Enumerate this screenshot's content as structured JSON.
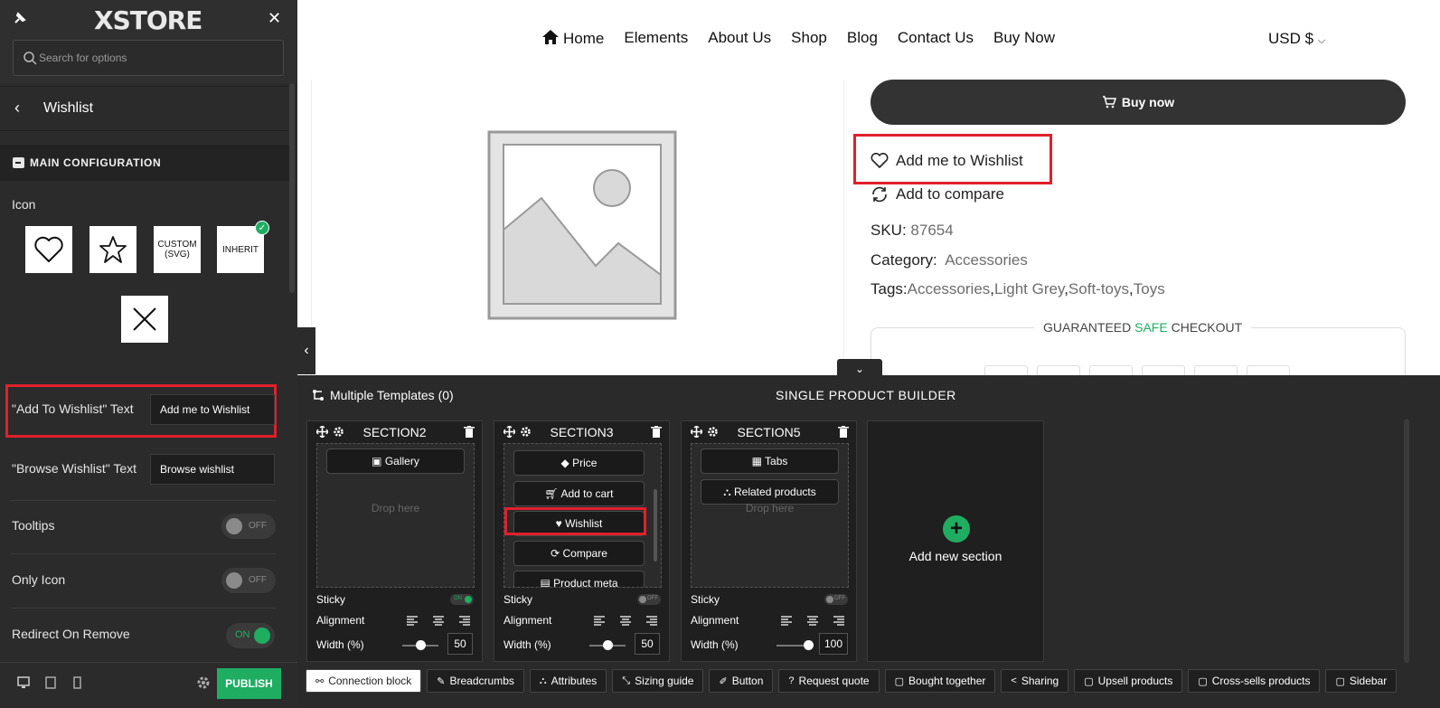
{
  "panel": {
    "logo": "XSTORE",
    "search_placeholder": "Search for options",
    "breadcrumb_title": "Wishlist",
    "section_title": "MAIN CONFIGURATION",
    "icon_label": "Icon",
    "icon_options": {
      "custom": "CUSTOM (SVG)",
      "inherit": "INHERIT"
    },
    "add_to_wishlist_label": "\"Add To Wishlist\" Text",
    "add_to_wishlist_value": "Add me to Wishlist",
    "browse_wishlist_label": "\"Browse Wishlist\" Text",
    "browse_wishlist_value": "Browse wishlist",
    "tooltips_label": "Tooltips",
    "tooltips_state": "OFF",
    "only_icon_label": "Only Icon",
    "only_icon_state": "OFF",
    "redirect_label": "Redirect On Remove",
    "redirect_state": "ON",
    "publish_label": "PUBLISH"
  },
  "preview": {
    "nav": [
      "Home",
      "Elements",
      "About Us",
      "Shop",
      "Blog",
      "Contact Us",
      "Buy Now"
    ],
    "currency": "USD $",
    "buy_now": "Buy now",
    "wishlist_link": "Add me to Wishlist",
    "compare_link": "Add to compare",
    "sku_label": "SKU:",
    "sku_value": "87654",
    "category_label": "Category:",
    "category_value": "Accessories",
    "tags_label": "Tags:",
    "tags": [
      "Accessories",
      "Light Grey",
      "Soft-toys",
      "Toys"
    ],
    "checkout_caption_pre": "GUARANTEED",
    "checkout_caption_safe": "SAFE",
    "checkout_caption_post": "CHECKOUT"
  },
  "builder": {
    "templates_label": "Multiple Templates (0)",
    "title": "SINGLE PRODUCT BUILDER",
    "drop_here": "Drop here",
    "sticky_label": "Sticky",
    "alignment_label": "Alignment",
    "width_label": "Width (%)",
    "sections": [
      {
        "name": "SECTION2",
        "blocks": [
          "Gallery"
        ],
        "sticky": "ON",
        "width": "50"
      },
      {
        "name": "SECTION3",
        "blocks": [
          "Price",
          "Add to cart",
          "Wishlist",
          "Compare",
          "Product meta"
        ],
        "sticky": "OFF",
        "width": "50"
      },
      {
        "name": "SECTION5",
        "blocks": [
          "Tabs",
          "Related products"
        ],
        "sticky": "OFF",
        "width": "100"
      }
    ],
    "add_section_label": "Add new section",
    "tabs": [
      "Connection block",
      "Breadcrumbs",
      "Attributes",
      "Sizing guide",
      "Button",
      "Request quote",
      "Bought together",
      "Sharing",
      "Upsell products",
      "Cross-sells products",
      "Sidebar"
    ]
  },
  "colors": {
    "accent": "#1fad62",
    "highlight": "#e0202c",
    "panel_bg": "#2b2b2b"
  }
}
